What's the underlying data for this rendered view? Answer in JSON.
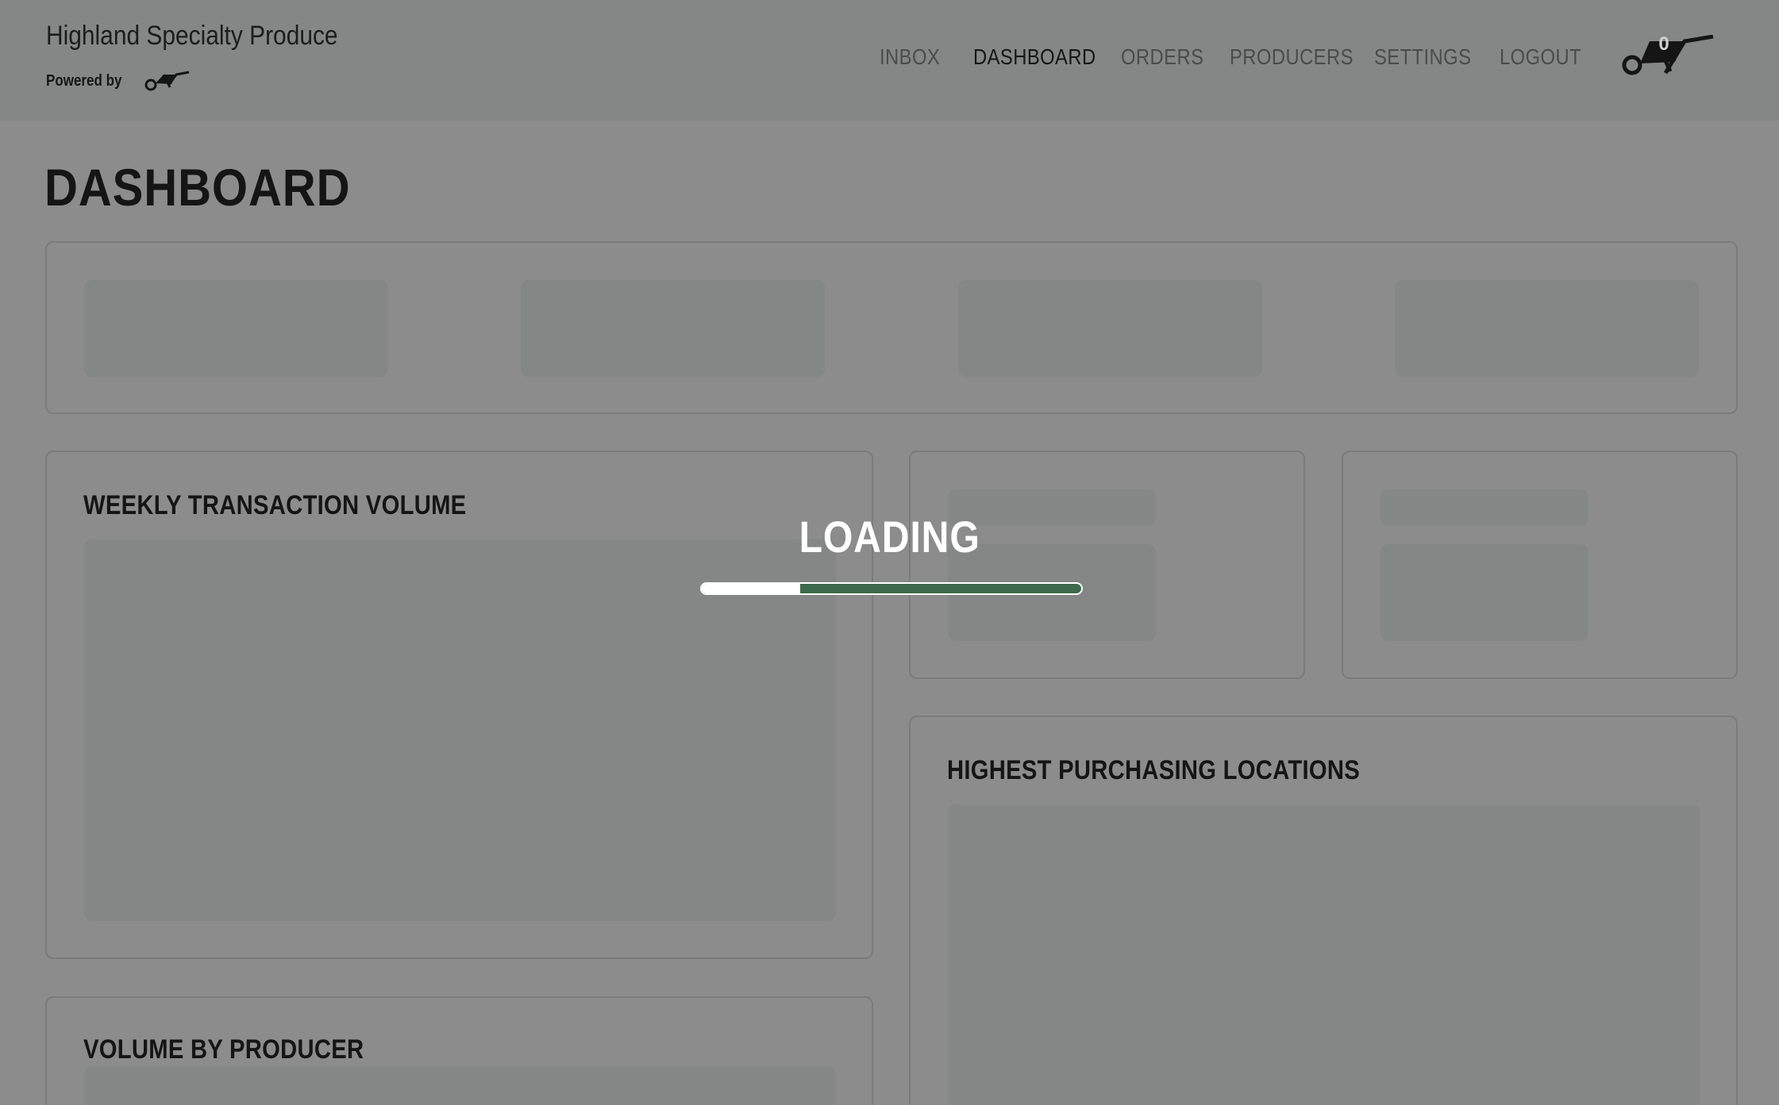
{
  "header": {
    "brand_name": "Highland Specialty Produce",
    "powered_by": "Powered by",
    "nav": [
      {
        "label": "INBOX",
        "active": false
      },
      {
        "label": "DASHBOARD",
        "active": true
      },
      {
        "label": "ORDERS",
        "active": false
      },
      {
        "label": "PRODUCERS",
        "active": false
      },
      {
        "label": "SETTINGS",
        "active": false
      },
      {
        "label": "LOGOUT",
        "active": false
      }
    ],
    "cart_count": "0"
  },
  "main": {
    "page_title": "DASHBOARD",
    "cards": {
      "weekly_transaction_volume": "WEEKLY TRANSACTION VOLUME",
      "highest_purchasing_locations": "HIGHEST PURCHASING LOCATIONS",
      "volume_by_producer": "VOLUME BY PRODUCER"
    }
  },
  "loading": {
    "label": "LOADING",
    "progress_fraction": 0.26
  },
  "colors": {
    "accent_green": "#3c6a4a",
    "overlay_gray": "#8b8c8b"
  }
}
